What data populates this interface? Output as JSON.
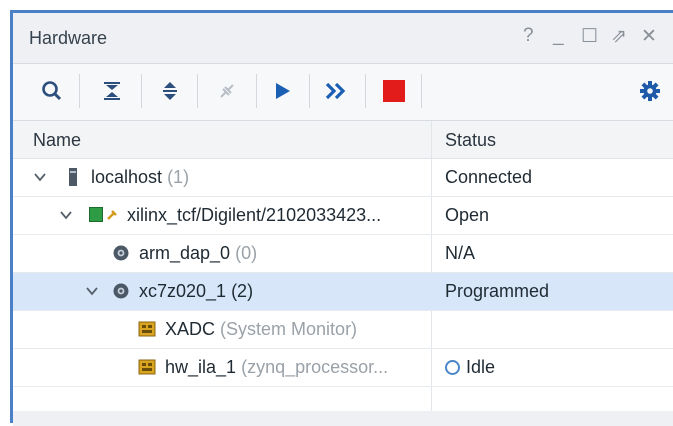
{
  "panel": {
    "title": "Hardware",
    "help": "?",
    "minimize": "_",
    "maximize": "☐",
    "restore": "⇗",
    "close": "✕"
  },
  "toolbar": {
    "items": [
      "search",
      "collapse-all",
      "expand-all",
      "auto-connect",
      "run-trigger",
      "run-trigger-immediate",
      "stop-trigger",
      "settings"
    ]
  },
  "table": {
    "columns": [
      "Name",
      "Status"
    ],
    "rows": [
      {
        "name": "localhost",
        "detail": "(1)",
        "status": "Connected"
      },
      {
        "name": "xilinx_tcf/Digilent/2102033423...",
        "detail": "",
        "status": "Open"
      },
      {
        "name": "arm_dap_0",
        "detail": "(0)",
        "status": "N/A"
      },
      {
        "name": "xc7z020_1 (2)",
        "detail": "",
        "status": "Programmed"
      },
      {
        "name": "XADC",
        "detail": "(System Monitor)",
        "status": ""
      },
      {
        "name": "hw_ila_1",
        "detail": "(zynq_processor...",
        "status": "Idle"
      }
    ]
  },
  "colors": {
    "accent": "#4a80c8",
    "selected_row": "#d7e6f8",
    "play": "#1a5fb4",
    "stop": "#e21b1b"
  }
}
